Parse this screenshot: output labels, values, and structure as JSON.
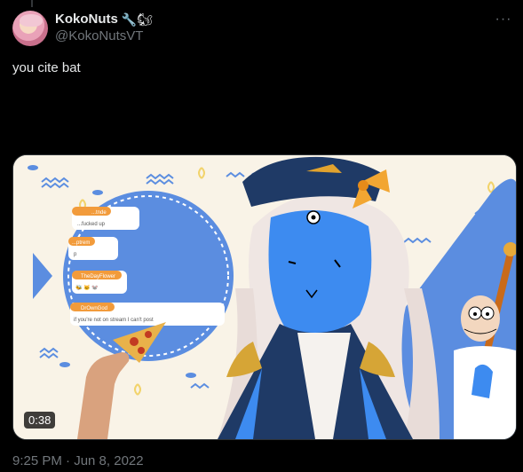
{
  "author": {
    "display_name": "KokoNuts",
    "badge_emojis": "🔧🐿",
    "handle": "@KokoNutsVT",
    "avatar_icon": "vtuber-avatar"
  },
  "tweet": {
    "text": "you cite bat",
    "timestamp": "9:25 PM · Jun 8, 2022"
  },
  "video": {
    "duration": "0:38",
    "chat_messages": [
      {
        "user": "...tnde",
        "text": "...fucked up"
      },
      {
        "user": "...ptrem",
        "text": "p"
      },
      {
        "user": "TheDayFlower",
        "text": "🐝 🐱 🐭"
      },
      {
        "user": "DrOwnGod",
        "text": "if you're not on stream I can't post"
      }
    ]
  },
  "colors": {
    "accent_blue": "#5b8de0",
    "background": "#000000",
    "secondary_text": "#71767b"
  }
}
